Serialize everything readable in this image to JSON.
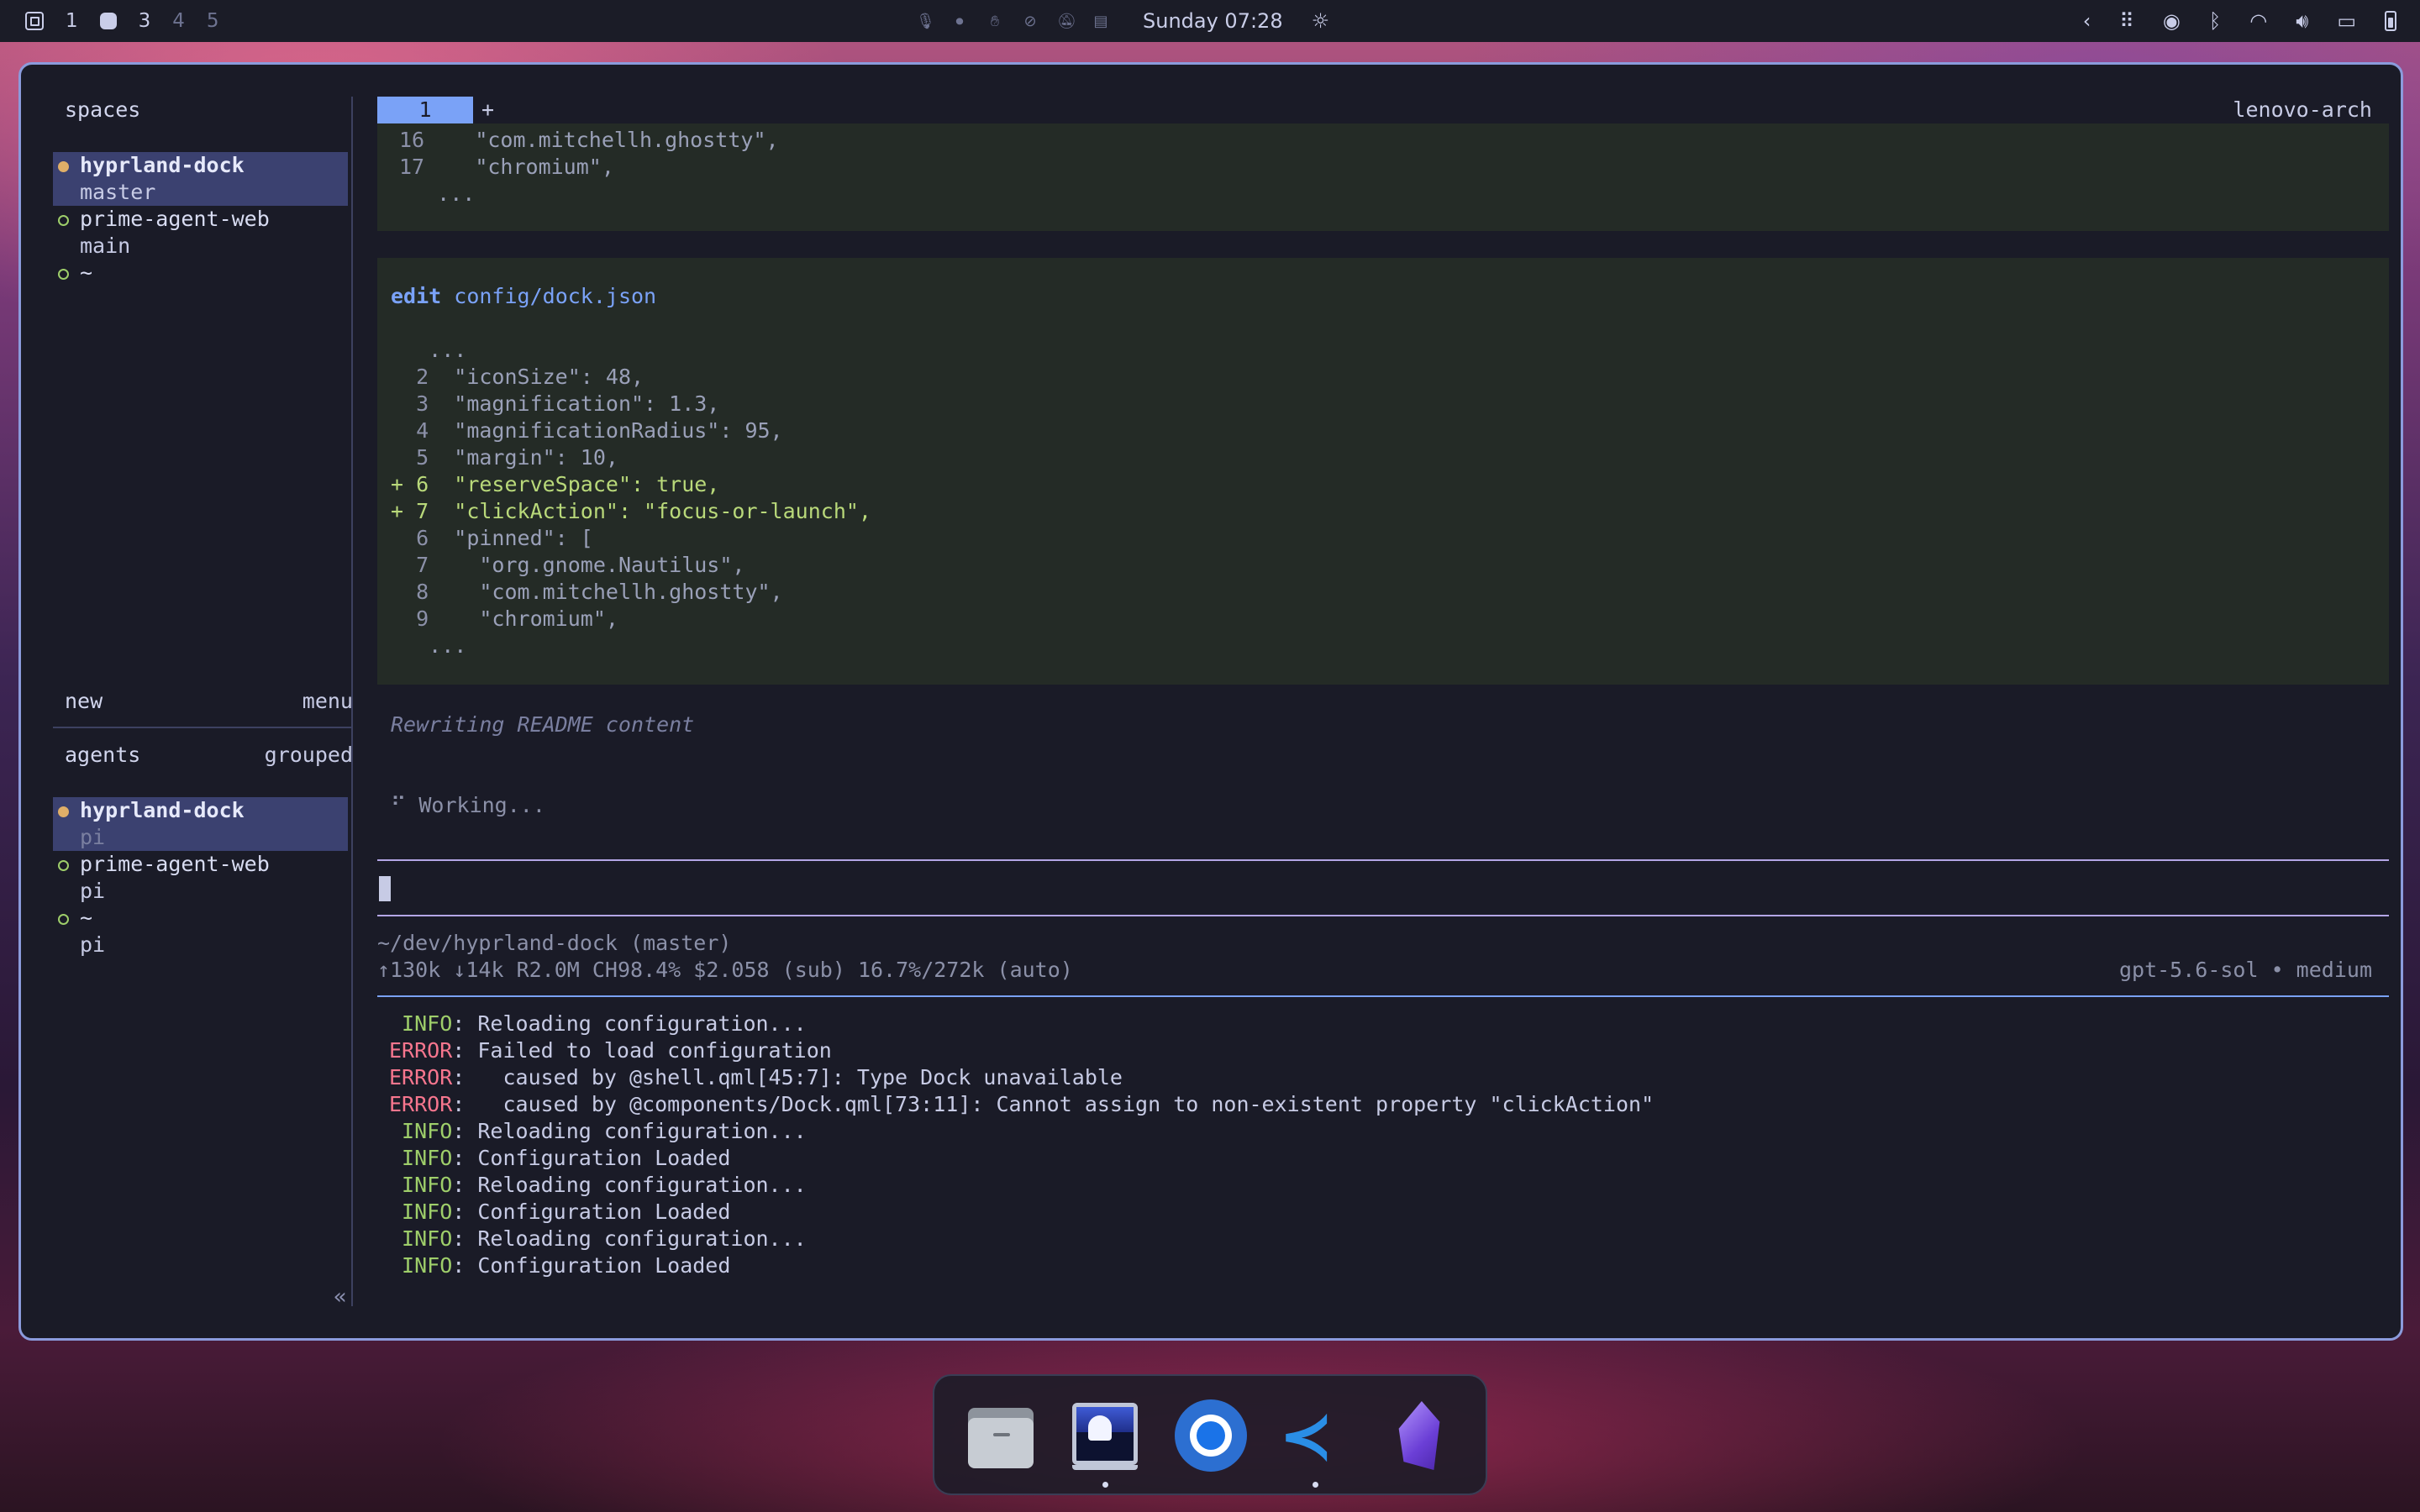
{
  "topbar": {
    "workspaces": [
      "1",
      "3",
      "4",
      "5"
    ],
    "clock": "Sunday 07:28"
  },
  "window": {
    "sidebar": {
      "spaces_title": "spaces",
      "spaces": [
        {
          "name": "hyprland-dock",
          "sub": "master",
          "active": true
        },
        {
          "name": "prime-agent-web",
          "sub": "main",
          "active": false
        },
        {
          "name": "~",
          "sub": "",
          "active": false
        }
      ],
      "new_label": "new",
      "menu_label": "menu",
      "agents_title": "agents",
      "grouped_label": "grouped",
      "agents": [
        {
          "name": "hyprland-dock",
          "sub": "pi",
          "active": true
        },
        {
          "name": "prime-agent-web",
          "sub": "pi",
          "active": false
        },
        {
          "name": "~",
          "sub": "pi",
          "active": false
        }
      ],
      "collapse_glyph": "«"
    },
    "main": {
      "tab_label": "1",
      "tab_add": "+",
      "hostname": "lenovo-arch",
      "top_block": [
        {
          "num": "16",
          "text": "    \"com.mitchellh.ghostty\","
        },
        {
          "num": "17",
          "text": "    \"chromium\","
        },
        {
          "num": "",
          "text": "   ..."
        }
      ],
      "edit_keyword": "edit",
      "edit_path": "config/dock.json",
      "diff_lines": [
        {
          "prefix": "",
          "num": "",
          "text": "   ..."
        },
        {
          "prefix": " ",
          "num": " 2",
          "text": "  \"iconSize\": 48,"
        },
        {
          "prefix": " ",
          "num": " 3",
          "text": "  \"magnification\": 1.3,"
        },
        {
          "prefix": " ",
          "num": " 4",
          "text": "  \"magnificationRadius\": 95,"
        },
        {
          "prefix": " ",
          "num": " 5",
          "text": "  \"margin\": 10,"
        },
        {
          "prefix": "+",
          "num": " 6",
          "text": "  \"reserveSpace\": true,"
        },
        {
          "prefix": "+",
          "num": " 7",
          "text": "  \"clickAction\": \"focus-or-launch\","
        },
        {
          "prefix": " ",
          "num": " 6",
          "text": "  \"pinned\": ["
        },
        {
          "prefix": " ",
          "num": " 7",
          "text": "    \"org.gnome.Nautilus\","
        },
        {
          "prefix": " ",
          "num": " 8",
          "text": "    \"com.mitchellh.ghostty\","
        },
        {
          "prefix": " ",
          "num": " 9",
          "text": "    \"chromium\","
        },
        {
          "prefix": "",
          "num": "",
          "text": "   ..."
        }
      ],
      "status_message": "Rewriting README content",
      "working_text": "⠋ Working...",
      "cwd": "~/dev/hyprland-dock (master)",
      "stats": "↑130k ↓14k R2.0M CH98.4% $2.058 (sub) 16.7%/272k (auto)",
      "model": "gpt-5.6-sol • medium",
      "logs": [
        {
          "level": " INFO",
          "text": ": Reloading configuration...",
          "type": "info"
        },
        {
          "level": "ERROR",
          "text": ": Failed to load configuration",
          "type": "error"
        },
        {
          "level": "ERROR",
          "text": ":   caused by @shell.qml[45:7]: Type Dock unavailable",
          "type": "error"
        },
        {
          "level": "ERROR",
          "text": ":   caused by @components/Dock.qml[73:11]: Cannot assign to non-existent property \"clickAction\"",
          "type": "error"
        },
        {
          "level": " INFO",
          "text": ": Reloading configuration...",
          "type": "info"
        },
        {
          "level": " INFO",
          "text": ": Configuration Loaded",
          "type": "info"
        },
        {
          "level": " INFO",
          "text": ": Reloading configuration...",
          "type": "info"
        },
        {
          "level": " INFO",
          "text": ": Configuration Loaded",
          "type": "info"
        },
        {
          "level": " INFO",
          "text": ": Reloading configuration...",
          "type": "info"
        },
        {
          "level": " INFO",
          "text": ": Configuration Loaded",
          "type": "info"
        }
      ]
    }
  },
  "dock": {
    "apps": [
      {
        "name": "files-icon",
        "running": false
      },
      {
        "name": "ghostty-icon",
        "running": true
      },
      {
        "name": "chromium-icon",
        "running": false
      },
      {
        "name": "vscode-icon",
        "running": true
      },
      {
        "name": "obsidian-icon",
        "running": false
      }
    ]
  },
  "colors": {
    "accent": "#7aa2f7",
    "info": "#9ece6a",
    "error": "#f7768e",
    "active_dot": "#e0af68",
    "diff_add": "#b9d97a",
    "window_border": "#8b9bdc",
    "prompt_border": "#b4a6e6"
  }
}
